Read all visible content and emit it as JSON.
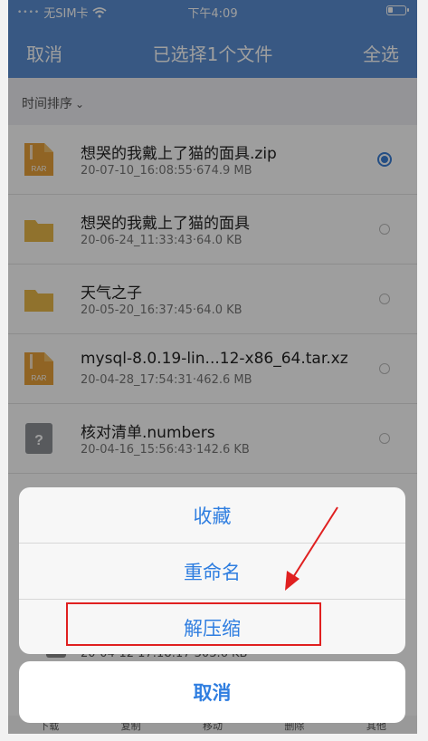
{
  "status": {
    "carrier": "无SIM卡",
    "time": "下午4:09"
  },
  "nav": {
    "left": "取消",
    "title": "已选择1个文件",
    "right": "全选"
  },
  "sort": {
    "label": "时间排序"
  },
  "files": [
    {
      "name": "想哭的我戴上了猫的面具.zip",
      "meta": "20-07-10_16:08:55·674.9 MB",
      "type": "rar",
      "icon_text": "RAR",
      "selected": true
    },
    {
      "name": "想哭的我戴上了猫的面具",
      "meta": "20-06-24_11:33:43·64.0 KB",
      "type": "folder",
      "selected": false
    },
    {
      "name": "天气之子",
      "meta": "20-05-20_16:37:45·64.0 KB",
      "type": "folder",
      "selected": false
    },
    {
      "name": "mysql-8.0.19-lin...12-x86_64.tar.xz",
      "meta": "20-04-28_17:54:31·462.6 MB",
      "type": "rar",
      "icon_text": "RAR",
      "selected": false
    },
    {
      "name": "核对清单.numbers",
      "meta": "20-04-16_15:56:43·142.6 KB",
      "type": "unknown",
      "icon_text": "?",
      "selected": false
    }
  ],
  "peek_meta": "20-04-12 17:18:17·303.6 KB",
  "sheet": {
    "items": [
      "收藏",
      "重命名",
      "解压缩"
    ],
    "cancel": "取消"
  },
  "tabbar": [
    "下载",
    "复制",
    "移动",
    "删除",
    "其他"
  ],
  "colors": {
    "nav_bg": "#5b8fd3",
    "accent": "#2f7ee0",
    "highlight": "#e02020",
    "folder": "#e8b84a",
    "rar": "#e8a23a"
  }
}
